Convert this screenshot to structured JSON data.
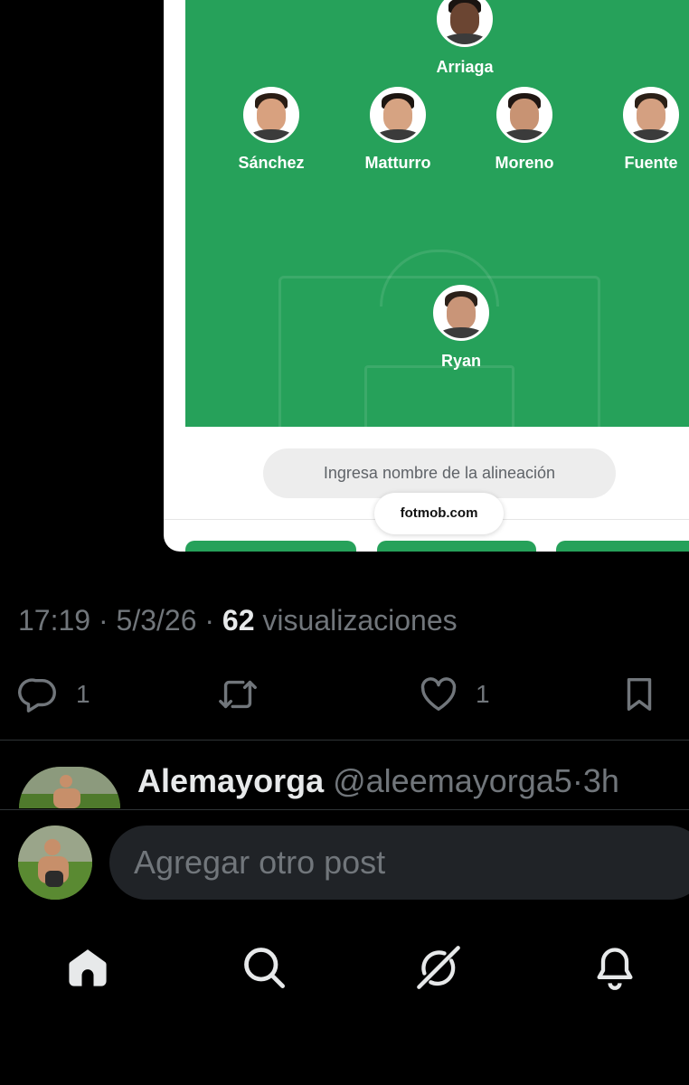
{
  "embed": {
    "lineup": {
      "players": [
        {
          "name": "Arriaga",
          "skin": "#6b4532",
          "hair": "#1a1411"
        },
        {
          "name": "Sánchez",
          "skin": "#d8a17f",
          "hair": "#2a1d14"
        },
        {
          "name": "Matturro",
          "skin": "#d6a382",
          "hair": "#1d1611"
        },
        {
          "name": "Moreno",
          "skin": "#c89373",
          "hair": "#1f1612"
        },
        {
          "name": "Fuente",
          "skin": "#d4a081",
          "hair": "#2b2017"
        },
        {
          "name": "Ryan",
          "skin": "#c99578",
          "hair": "#2b2019"
        }
      ]
    },
    "lineup_name_placeholder": "Ingresa nombre de la alineación",
    "source": "fotmob.com",
    "colors": {
      "pitch": "#26a15a"
    }
  },
  "tweet": {
    "time": "17:19",
    "date": "5/3/26",
    "separator": "·",
    "views_count": "62",
    "views_label": "visualizaciones",
    "replies": "1",
    "likes": "1"
  },
  "reply": {
    "name": "Alemayorga",
    "handle": "@aleemayorga5",
    "time": "3h",
    "separator": "·"
  },
  "compose": {
    "placeholder": "Agregar otro post"
  },
  "nav": {
    "items": [
      "home-icon",
      "search-icon",
      "grok-icon",
      "notifications-icon"
    ]
  }
}
